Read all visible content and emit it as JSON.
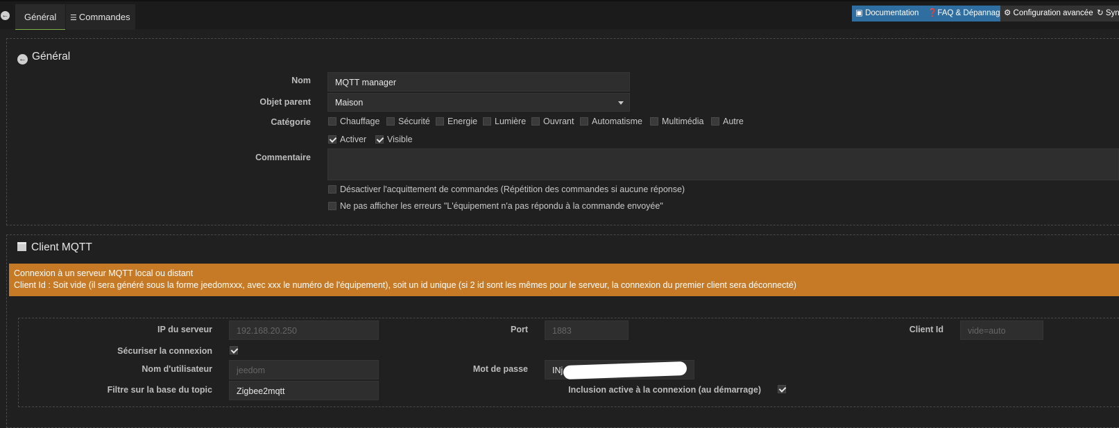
{
  "tabs": {
    "general": "Général",
    "commands": "Commandes"
  },
  "toolbar": {
    "documentation": "Documentation",
    "faq": "FAQ & Dépannage",
    "advanced": "Configuration avancée",
    "sync": "Syn"
  },
  "general": {
    "legend": "Général",
    "name_label": "Nom",
    "name_value": "MQTT manager",
    "parent_label": "Objet parent",
    "parent_value": "Maison",
    "category_label": "Catégorie",
    "categories": [
      "Chauffage",
      "Sécurité",
      "Energie",
      "Lumière",
      "Ouvrant",
      "Automatisme",
      "Multimédia",
      "Autre"
    ],
    "activate_label": "Activer",
    "visible_label": "Visible",
    "comment_label": "Commentaire",
    "disable_ack_label": "Désactiver l'acquittement de commandes (Répétition des commandes si aucune réponse)",
    "hide_errors_label": "Ne pas afficher les erreurs \"L'équipement n'a pas répondu à la commande envoyée\""
  },
  "client": {
    "legend": "Client MQTT",
    "alert_line1": "Connexion à un serveur MQTT local ou distant",
    "alert_line2": "Client Id : Soit vide (il sera généré sous la forme jeedomxxx, avec xxx le numéro de l'équipement), soit un id unique (si 2 id sont les mêmes pour le serveur, la connexion du premier client sera déconnecté)",
    "ip_label": "IP du serveur",
    "ip_placeholder": "192.168.20.250",
    "port_label": "Port",
    "port_placeholder": "1883",
    "client_id_label": "Client Id",
    "client_id_placeholder": "vide=auto",
    "secure_label": "Sécuriser la connexion",
    "user_label": "Nom d'utilisateur",
    "user_placeholder": "jeedom",
    "password_label": "Mot de passe",
    "password_value": "INj",
    "topic_label": "Filtre sur la base du topic",
    "topic_value": "Zigbee2mqtt",
    "inclusion_label": "Inclusion active à la connexion (au démarrage)"
  }
}
